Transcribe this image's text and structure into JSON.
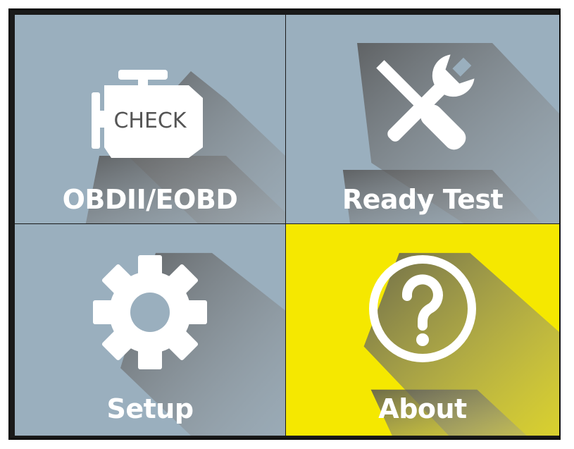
{
  "menu": {
    "items": [
      {
        "label": "OBDII/EOBD",
        "icon": "check-engine-icon",
        "selected": false
      },
      {
        "label": "Ready Test",
        "icon": "wrench-screwdriver-icon",
        "selected": false
      },
      {
        "label": "Setup",
        "icon": "gear-icon",
        "selected": false
      },
      {
        "label": "About",
        "icon": "question-icon",
        "selected": true
      }
    ],
    "check_icon_text": "CHECK"
  },
  "colors": {
    "tile_background": "#9aafbe",
    "selected_background": "#f5e800",
    "label_color": "#ffffff"
  }
}
